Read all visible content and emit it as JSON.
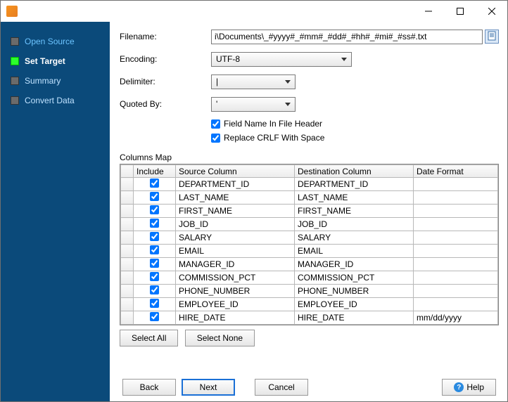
{
  "titlebar": {
    "title": ""
  },
  "sidebar": {
    "steps": [
      {
        "label": "Open Source"
      },
      {
        "label": "Set Target"
      },
      {
        "label": "Summary"
      },
      {
        "label": "Convert Data"
      }
    ]
  },
  "form": {
    "filename_label": "Filename:",
    "filename_value": "i\\Documents\\_#yyyy#_#mm#_#dd#_#hh#_#mi#_#ss#.txt",
    "encoding_label": "Encoding:",
    "encoding_value": "UTF-8",
    "delimiter_label": "Delimiter:",
    "delimiter_value": "|",
    "quoted_label": "Quoted By:",
    "quoted_value": "'",
    "chk_header_label": "Field Name In File Header",
    "chk_crlf_label": "Replace CRLF With Space",
    "columns_map_label": "Columns Map",
    "headers": {
      "include": "Include",
      "source": "Source Column",
      "dest": "Destination Column",
      "datefmt": "Date Format"
    },
    "rows": [
      {
        "source": "DEPARTMENT_ID",
        "dest": "DEPARTMENT_ID",
        "datefmt": ""
      },
      {
        "source": "LAST_NAME",
        "dest": "LAST_NAME",
        "datefmt": ""
      },
      {
        "source": "FIRST_NAME",
        "dest": "FIRST_NAME",
        "datefmt": ""
      },
      {
        "source": "JOB_ID",
        "dest": "JOB_ID",
        "datefmt": ""
      },
      {
        "source": "SALARY",
        "dest": "SALARY",
        "datefmt": ""
      },
      {
        "source": "EMAIL",
        "dest": "EMAIL",
        "datefmt": ""
      },
      {
        "source": "MANAGER_ID",
        "dest": "MANAGER_ID",
        "datefmt": ""
      },
      {
        "source": "COMMISSION_PCT",
        "dest": "COMMISSION_PCT",
        "datefmt": ""
      },
      {
        "source": "PHONE_NUMBER",
        "dest": "PHONE_NUMBER",
        "datefmt": ""
      },
      {
        "source": "EMPLOYEE_ID",
        "dest": "EMPLOYEE_ID",
        "datefmt": ""
      },
      {
        "source": "HIRE_DATE",
        "dest": "HIRE_DATE",
        "datefmt": "mm/dd/yyyy"
      }
    ],
    "select_all": "Select All",
    "select_none": "Select None"
  },
  "footer": {
    "back": "Back",
    "next": "Next",
    "cancel": "Cancel",
    "help": "Help"
  }
}
